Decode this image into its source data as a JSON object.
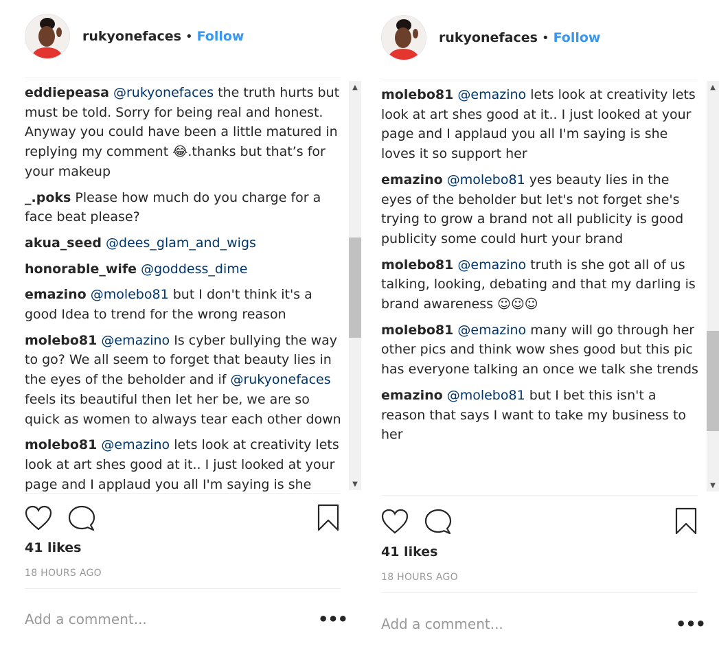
{
  "panels": [
    {
      "header": {
        "username": "rukyonefaces",
        "separator": "•",
        "follow_label": "Follow"
      },
      "comments": [
        {
          "user": "eddiepeasa",
          "mention": "@rukyonefaces",
          "text": " the truth hurts but must be told. Sorry for being real and honest. Anyway you could have been a little matured in replying my comment 😂.thanks but that’s for your makeup"
        },
        {
          "user": "_.poks",
          "mention": "",
          "text": "Please how much do you charge for a face beat please?"
        },
        {
          "user": "akua_seed",
          "mention": "@dees_glam_and_wigs",
          "text": ""
        },
        {
          "user": "honorable_wife",
          "mention": "@goddess_dime",
          "text": ""
        },
        {
          "user": "emazino",
          "mention": "@molebo81",
          "text": " but I don't think it's a good Idea to trend for the wrong reason"
        },
        {
          "user": "molebo81",
          "mention": "@emazino",
          "text": " Is cyber bullying the way to go? We all seem to forget that beauty lies in the eyes of the beholder and if ",
          "mention2": "@rukyonefaces",
          "text2": " feels its beautiful then let her be, we are so quick as women to always tear each other down"
        },
        {
          "user": "molebo81",
          "mention": "@emazino",
          "text": " lets look at creativity lets look at art shes good at it.. I just looked at your page and I applaud you all I'm saying is she loves it so support her"
        }
      ],
      "likes": "41 likes",
      "timestamp": "18 HOURS AGO",
      "add_comment_placeholder": "Add a comment...",
      "more_label": "•••"
    },
    {
      "header": {
        "username": "rukyonefaces",
        "separator": "•",
        "follow_label": "Follow"
      },
      "comments": [
        {
          "user": "molebo81",
          "mention": "@emazino",
          "text": " lets look at creativity lets look at art shes good at it.. I just looked at your page and I applaud you all I'm saying is she loves it so support her"
        },
        {
          "user": "emazino",
          "mention": "@molebo81",
          "text": " yes beauty lies in the eyes of the beholder but let's not forget she's trying to grow a brand not all publicity is good publicity some could hurt your brand"
        },
        {
          "user": "molebo81",
          "mention": "@emazino",
          "text": " truth is she got all of us talking, looking, debating and that my darling is brand awareness ☺☺☺"
        },
        {
          "user": "molebo81",
          "mention": "@emazino",
          "text": " many will go through her other pics and think wow shes good but this pic has everyone talking an once we talk she trends"
        },
        {
          "user": "emazino",
          "mention": "@molebo81",
          "text": " but I bet this isn't a reason that says I want to take my business to her"
        }
      ],
      "likes": "41 likes",
      "timestamp": "18 HOURS AGO",
      "add_comment_placeholder": "Add a comment...",
      "more_label": "•••"
    }
  ],
  "colors": {
    "link": "#3897f0",
    "mention": "#003569",
    "text": "#262626",
    "muted": "#999999"
  },
  "icons": [
    "heart-icon",
    "comment-bubble-icon",
    "bookmark-icon",
    "scroll-up-arrow-icon",
    "scroll-down-arrow-icon"
  ]
}
